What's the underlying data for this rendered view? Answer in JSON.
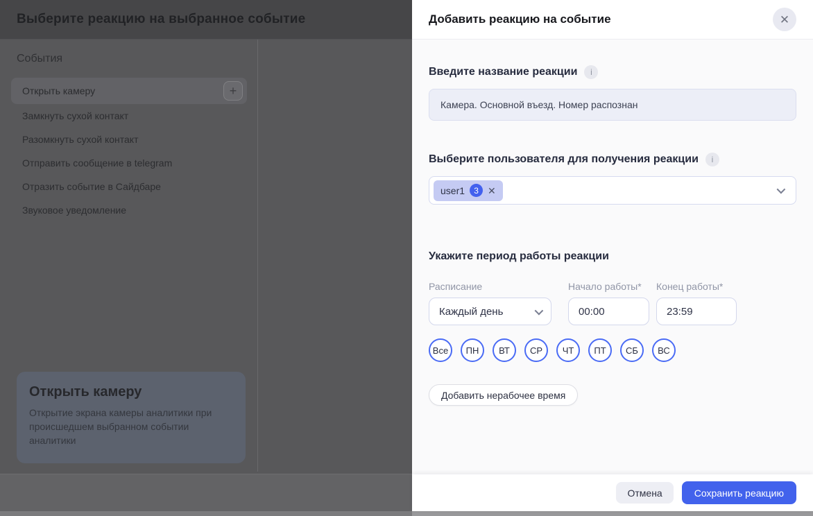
{
  "backdrop": {
    "page_title": "Выберите реакцию на выбранное событие",
    "events_section_title": "События",
    "selected_event": {
      "label": "Открыть камеру",
      "add_icon": "+"
    },
    "events": [
      "Замкнуть сухой контакт",
      "Разомкнуть сухой контакт",
      "Отправить сообщение в telegram",
      "Отразить событие в Сайдбаре",
      "Звуковое уведомление"
    ],
    "info_card": {
      "title": "Открыть камеру",
      "description": "Открытие экрана камеры аналитики при происшедшем выбранном событии аналитики"
    }
  },
  "modal": {
    "title": "Добавить реакцию на событие",
    "close_icon": "✕",
    "name_section": {
      "label": "Введите название реакции",
      "info_icon": "i",
      "value": "Камера. Основной въезд. Номер распознан"
    },
    "user_section": {
      "label": "Выберите пользователя для получения реакции",
      "info_icon": "i",
      "tag": {
        "name": "user1",
        "count": "3",
        "remove_icon": "✕"
      }
    },
    "period_section": {
      "title": "Укажите период работы реакции",
      "schedule": {
        "label": "Расписание",
        "value": "Каждый день"
      },
      "start": {
        "label": "Начало работы",
        "required_mark": "*",
        "value": "00:00"
      },
      "end": {
        "label": "Конец работы",
        "required_mark": "*",
        "value": "23:59"
      },
      "days": [
        "Все",
        "ПН",
        "ВТ",
        "СР",
        "ЧТ",
        "ПТ",
        "СБ",
        "ВС"
      ],
      "add_downtime_label": "Добавить нерабочее время"
    },
    "footer": {
      "cancel_label": "Отмена",
      "save_label": "Сохранить реакцию"
    }
  },
  "colors": {
    "accent": "#4262ec",
    "day_chip_border": "#4a6bf5",
    "tag_background": "#c5cbf3",
    "input_background": "#eceef7"
  }
}
